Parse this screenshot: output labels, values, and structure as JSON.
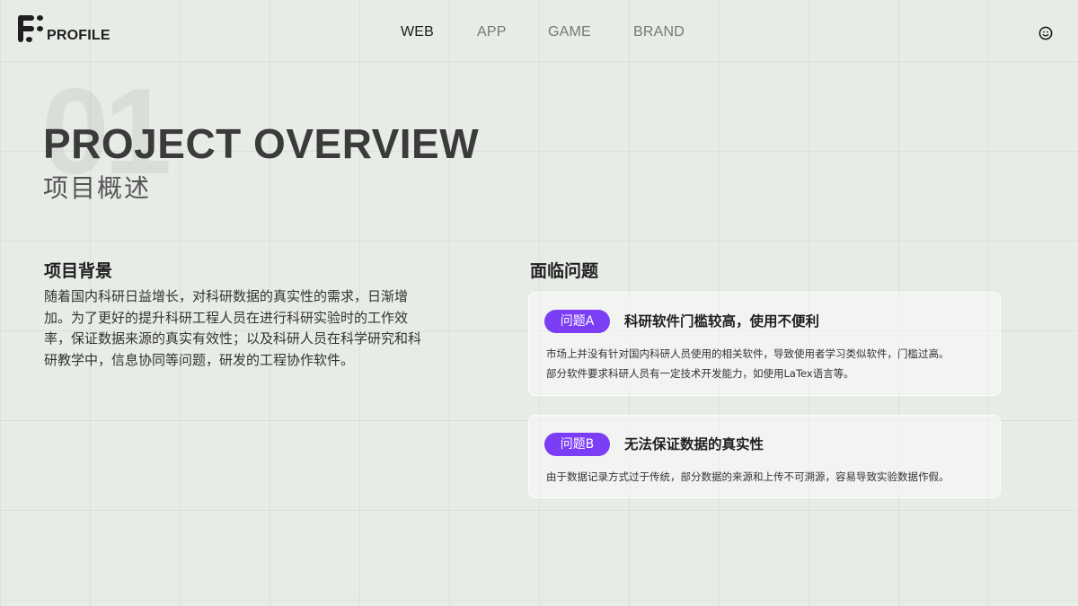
{
  "header": {
    "logo_text": "PROFILE",
    "nav": [
      {
        "label": "WEB",
        "active": true
      },
      {
        "label": "APP",
        "active": false
      },
      {
        "label": "GAME",
        "active": false
      },
      {
        "label": "BRAND",
        "active": false
      }
    ],
    "right_icon": "smiley-icon"
  },
  "hero": {
    "number": "01",
    "title_en": "PROJECT OVERVIEW",
    "title_cn": "项目概述"
  },
  "background": {
    "title": "项目背景",
    "text": "随着国内科研日益增长，对科研数据的真实性的需求，日渐增加。为了更好的提升科研工程人员在进行科研实验时的工作效率，保证数据来源的真实有效性；以及科研人员在科学研究和科研教学中，信息协同等问题，研发的工程协作软件。"
  },
  "problems": {
    "title": "面临问题",
    "cards": [
      {
        "badge": "问题A",
        "title": "科研软件门槛较高，使用不便利",
        "lines": [
          "市场上并没有针对国内科研人员使用的相关软件，导致使用者学习类似软件，门槛过高。",
          "部分软件要求科研人员有一定技术开发能力，如使用LaTex语言等。"
        ]
      },
      {
        "badge": "问题B",
        "title": "无法保证数据的真实性",
        "lines": [
          "由于数据记录方式过于传统，部分数据的来源和上传不可溯源，容易导致实验数据作假。"
        ]
      }
    ]
  },
  "colors": {
    "background": "#e8ece7",
    "accent": "#7b3ef6",
    "text_dark": "#1f1f1f"
  }
}
